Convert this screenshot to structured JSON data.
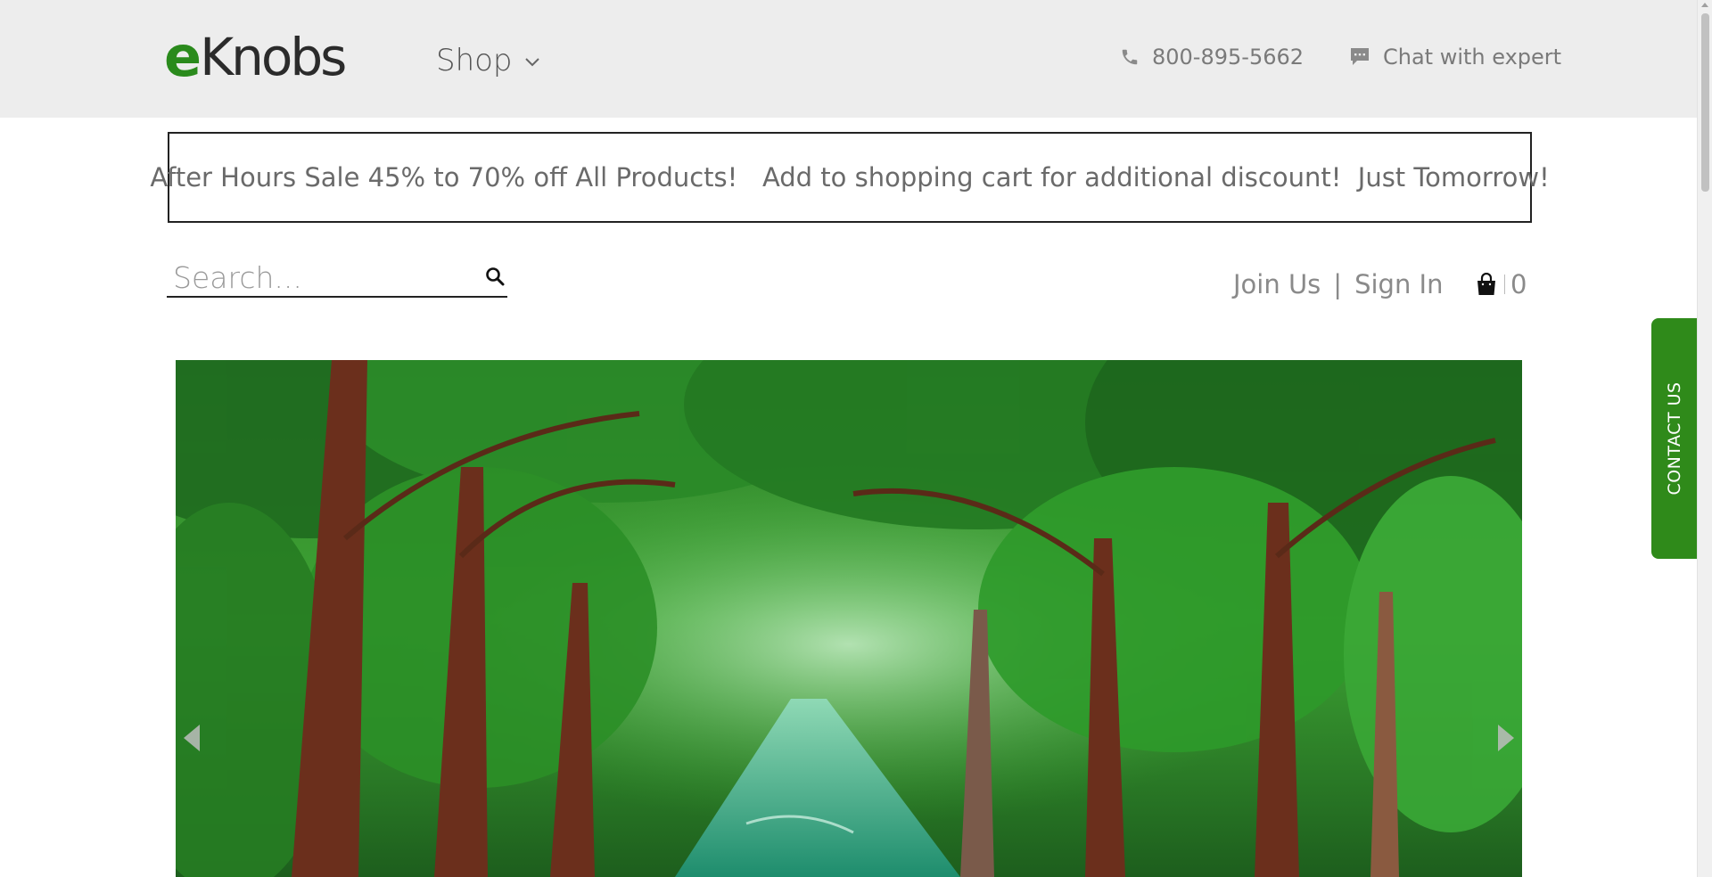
{
  "header": {
    "logo_e": "e",
    "logo_rest": "Knobs",
    "shop_label": "Shop",
    "phone": "800-895-5662",
    "chat_label": "Chat with expert"
  },
  "promo": {
    "text": "After Hours Sale 45% to 70% off All Products!   Add to shopping cart for additional discount!  Just Tomorrow!"
  },
  "search": {
    "placeholder": "Search..."
  },
  "account": {
    "join_label": "Join Us",
    "separator": "|",
    "signin_label": "Sign In"
  },
  "cart": {
    "count": "0"
  },
  "contact_tab": {
    "label": "CONTACT US"
  },
  "colors": {
    "brand_green": "#2a8a1c",
    "header_bg": "#ededed",
    "contact_tab_bg": "#2f8a1a"
  },
  "icons": {
    "shop": "chevron-down-icon",
    "phone": "phone-icon",
    "chat": "chat-bubble-icon",
    "search": "search-icon",
    "cart": "shopping-bag-icon",
    "carousel_prev": "arrow-left-icon",
    "carousel_next": "arrow-right-icon"
  }
}
